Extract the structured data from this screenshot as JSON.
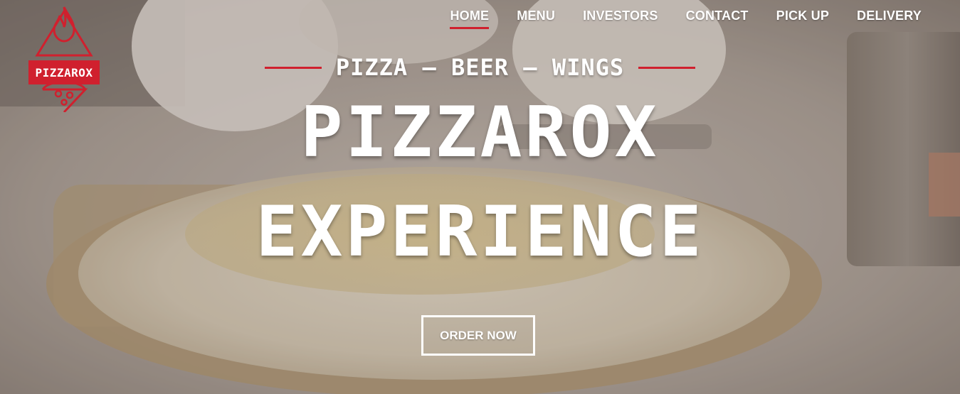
{
  "brand": {
    "logo_text": "PIZZAROX",
    "accent_color": "#d0202e"
  },
  "nav": {
    "items": [
      {
        "label": "HOME",
        "active": true
      },
      {
        "label": "MENU",
        "active": false
      },
      {
        "label": "INVESTORS",
        "active": false
      },
      {
        "label": "CONTACT",
        "active": false
      },
      {
        "label": "PICK UP",
        "active": false
      },
      {
        "label": "DELIVERY",
        "active": false
      }
    ]
  },
  "hero": {
    "tagline": "PIZZA — BEER — WINGS",
    "headline_line1": "PIZZAROX",
    "headline_line2": "EXPERIENCE",
    "cta_label": "ORDER NOW",
    "background": "pizza-preparation-photo"
  },
  "icons": {
    "logo": "pizza-flame-logo-icon"
  }
}
